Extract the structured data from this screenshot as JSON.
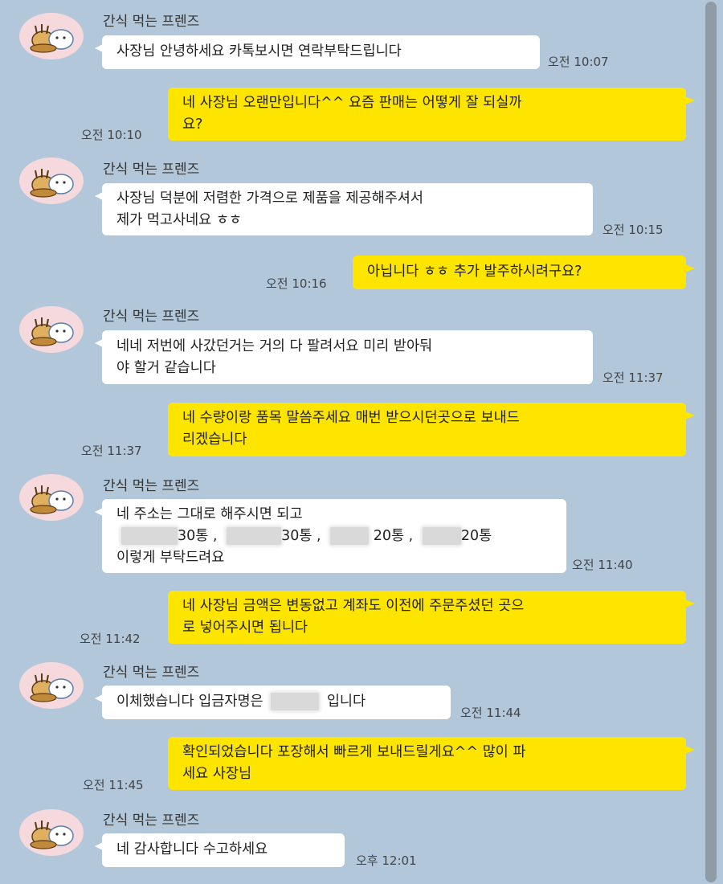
{
  "sender_name": "간식 먹는 프렌즈",
  "messages": [
    {
      "from": "friend",
      "lines": [
        "사장님 안녕하세요 카톡보시면 연락부탁드립니다"
      ],
      "time": "오전 10:07"
    },
    {
      "from": "me",
      "lines": [
        "네 사장님 오랜만입니다^^ 요즘 판매는 어떻게 잘 되실까",
        "요?"
      ],
      "time": "오전 10:10"
    },
    {
      "from": "friend",
      "lines": [
        "사장님 덕분에 저렴한 가격으로 제품을 제공해주셔서",
        "제가 먹고사네요 ㅎㅎ"
      ],
      "time": "오전 10:15"
    },
    {
      "from": "me",
      "lines": [
        "아닙니다 ㅎㅎ 추가 발주하시려구요?"
      ],
      "time": "오전 10:16"
    },
    {
      "from": "friend",
      "lines": [
        "네네 저번에 사갔던거는 거의 다 팔려서요 미리 받아둬",
        "야 할거 같습니다"
      ],
      "time": "오전 11:37"
    },
    {
      "from": "me",
      "lines": [
        "네 수량이랑 품목 말씀주세요 매번 받으시던곳으로 보내드",
        "리겠습니다"
      ],
      "time": "오전 11:37"
    },
    {
      "from": "friend",
      "lines": [
        "네 주소는 그대로 해주시면 되고",
        "",
        "이렇게 부탁드려요"
      ],
      "order": [
        "30통",
        "30통",
        "20통",
        "20통"
      ],
      "time": "오전 11:40"
    },
    {
      "from": "me",
      "lines": [
        "네 사장님 금액은 변동없고 계좌도 이전에 주문주셨던 곳으",
        "로 넣어주시면 됩니다"
      ],
      "time": "오전 11:42"
    },
    {
      "from": "friend",
      "lines": [
        "이체했습니다 입금자명은"
      ],
      "suffix": "입니다",
      "time": "오전 11:44"
    },
    {
      "from": "me",
      "lines": [
        "확인되었습니다 포장해서 빠르게 보내드릴게요^^ 많이 파",
        "세요 사장님"
      ],
      "time": "오전 11:45"
    },
    {
      "from": "friend",
      "lines": [
        "네 감사합니다 수고하세요"
      ],
      "time": "오후 12:01"
    }
  ],
  "avatar_icon": "rabbit-and-bear-snack-icon",
  "colors": {
    "background": "#b2c7da",
    "incoming_bubble": "#ffffff",
    "outgoing_bubble": "#fee500",
    "avatar_bg": "#f6d9dc"
  }
}
